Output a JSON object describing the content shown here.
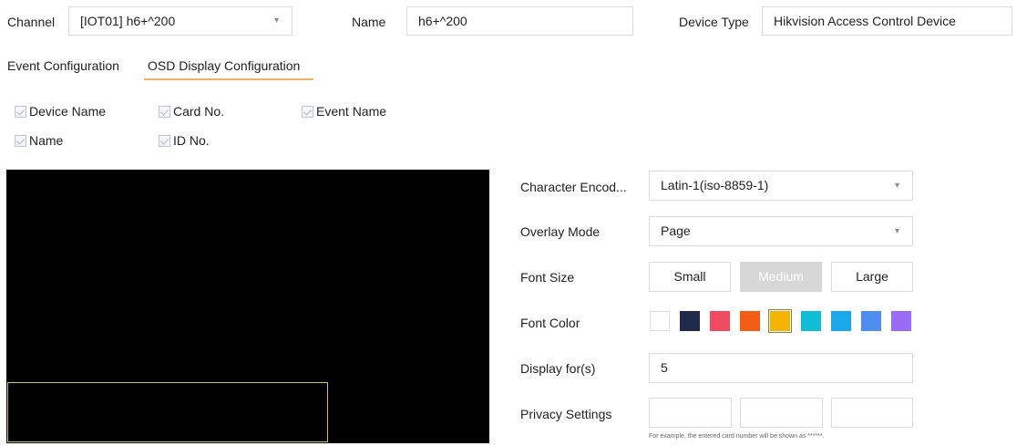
{
  "header": {
    "channel_label": "Channel",
    "channel_value": "[IOT01] h6+^200",
    "name_label": "Name",
    "name_value": "h6+^200",
    "device_type_label": "Device Type",
    "device_type_value": "Hikvision Access Control Device"
  },
  "tabs": [
    {
      "label": "Event Configuration",
      "active": false
    },
    {
      "label": "OSD Display Configuration",
      "active": true
    }
  ],
  "checkboxes": [
    {
      "label": "Device Name",
      "checked": true
    },
    {
      "label": "Card No.",
      "checked": true
    },
    {
      "label": "Event Name",
      "checked": true
    },
    {
      "label": "Name",
      "checked": true
    },
    {
      "label": "ID No.",
      "checked": true
    }
  ],
  "settings": {
    "character_encoding_label": "Character Encod...",
    "character_encoding_value": "Latin-1(iso-8859-1)",
    "overlay_mode_label": "Overlay Mode",
    "overlay_mode_value": "Page",
    "font_size_label": "Font Size",
    "font_sizes": [
      "Small",
      "Medium",
      "Large"
    ],
    "font_size_selected": "Medium",
    "font_color_label": "Font Color",
    "font_colors": [
      "#ffffff",
      "#1f2a4d",
      "#ee4b63",
      "#f25c14",
      "#f5b400",
      "#10bcd6",
      "#1aa8ea",
      "#4f8ef0",
      "#9a6cf6"
    ],
    "font_color_selected": "#f5b400",
    "display_for_label": "Display for(s)",
    "display_for_value": "5",
    "privacy_label": "Privacy Settings",
    "privacy_hint": "For example, the entered card number will be shown as ******."
  },
  "icons": {
    "dropdown": "chevron-down-icon",
    "checkbox": "checkmark-icon"
  }
}
